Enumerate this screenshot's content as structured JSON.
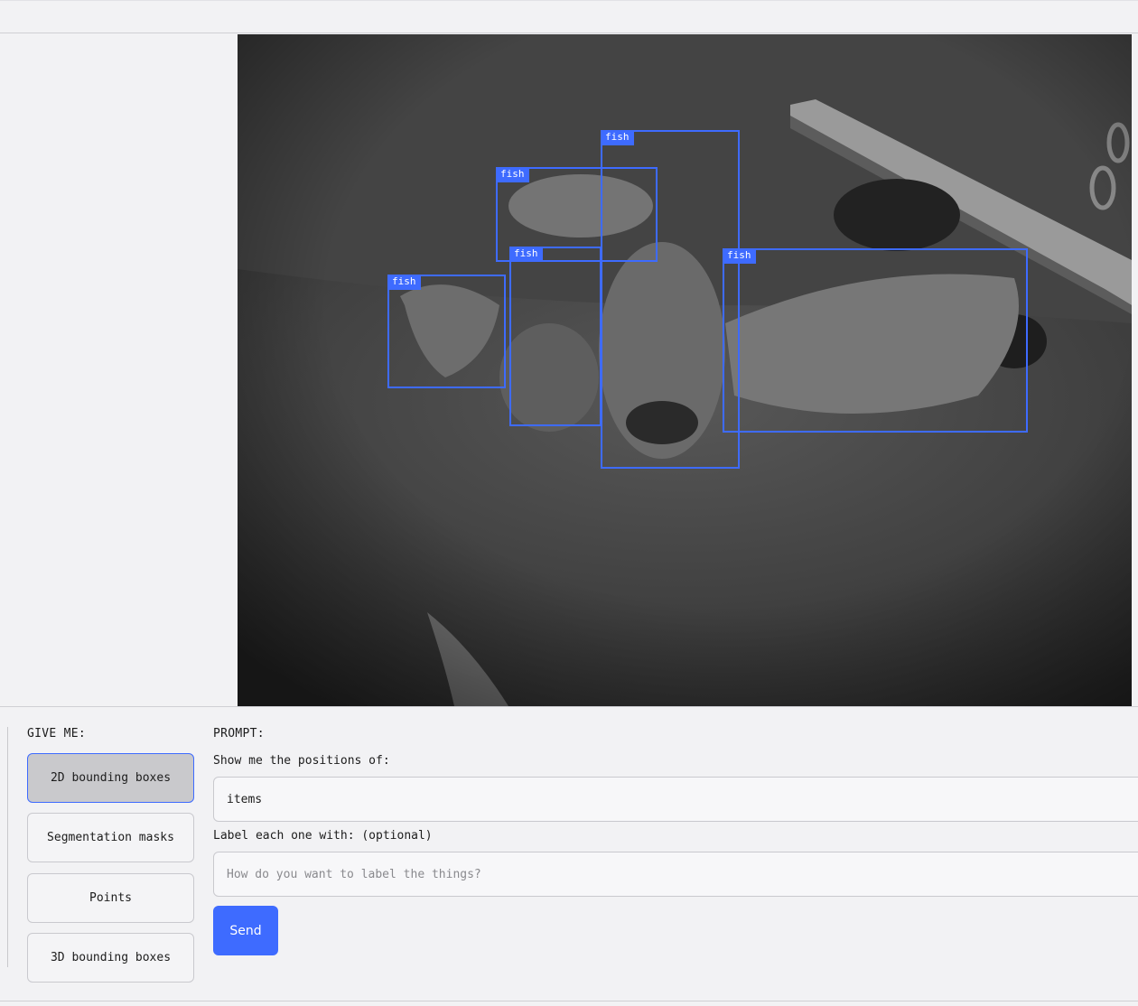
{
  "image": {
    "detections": [
      {
        "label": "fish"
      },
      {
        "label": "fish"
      },
      {
        "label": "fish"
      },
      {
        "label": "fish"
      },
      {
        "label": "fish"
      }
    ],
    "box_color": "#3e6bff"
  },
  "controls": {
    "give_me_title": "GIVE ME:",
    "modes": [
      {
        "label": "2D bounding boxes",
        "active": true
      },
      {
        "label": "Segmentation masks",
        "active": false
      },
      {
        "label": "Points",
        "active": false
      },
      {
        "label": "3D bounding boxes",
        "active": false
      }
    ],
    "prompt_title": "PROMPT:",
    "positions_label": "Show me the positions of:",
    "positions_value": "items",
    "label_label": "Label each one with: (optional)",
    "label_placeholder": "How do you want to label the things?",
    "label_value": "",
    "send_label": "Send"
  },
  "colors": {
    "accent": "#3e6bff",
    "background": "#f2f2f4",
    "active_mode": "#c9c9cc"
  }
}
